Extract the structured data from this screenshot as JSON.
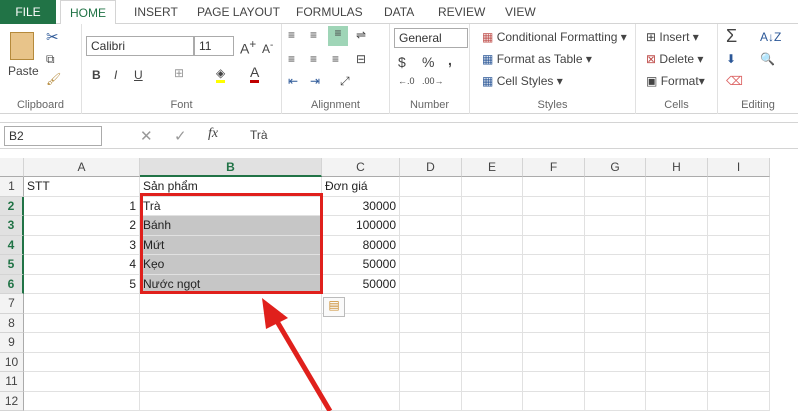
{
  "tabs": [
    "FILE",
    "HOME",
    "INSERT",
    "PAGE LAYOUT",
    "FORMULAS",
    "DATA",
    "REVIEW",
    "VIEW"
  ],
  "clipboard": {
    "paste": "Paste",
    "label": "Clipboard"
  },
  "font": {
    "name": "Calibri",
    "size": "11",
    "label": "Font",
    "bold": "B",
    "italic": "I",
    "underline": "U"
  },
  "alignment": {
    "label": "Alignment"
  },
  "number": {
    "format": "General",
    "currency": "$",
    "percent": "%",
    "comma": ",",
    "label": "Number"
  },
  "styles": {
    "conditional": "Conditional Formatting",
    "table": "Format as Table",
    "cell_styles": "Cell Styles",
    "label": "Styles"
  },
  "cells": {
    "insert": "Insert",
    "delete": "Delete",
    "format": "Format",
    "label": "Cells"
  },
  "editing": {
    "label": "Editing",
    "sum": "Σ"
  },
  "formula_bar": {
    "name_box": "B2",
    "fx": "fx",
    "value": "Trà"
  },
  "columns": [
    "A",
    "B",
    "C",
    "D",
    "E",
    "F",
    "G",
    "H",
    "I"
  ],
  "rows": [
    "1",
    "2",
    "3",
    "4",
    "5",
    "6",
    "7",
    "8",
    "9",
    "10",
    "11",
    "12"
  ],
  "table": {
    "header": [
      "STT",
      "Sản phẩm",
      "Đơn giá"
    ],
    "data": [
      [
        "1",
        "Trà",
        "30000"
      ],
      [
        "2",
        "Bánh",
        "100000"
      ],
      [
        "3",
        "Mứt",
        "80000"
      ],
      [
        "4",
        "Kẹo",
        "50000"
      ],
      [
        "5",
        "Nước ngọt",
        "50000"
      ]
    ]
  },
  "colors": {
    "accent": "#217346",
    "highlight": "#e0201c",
    "selection": "#c6c6c6"
  }
}
